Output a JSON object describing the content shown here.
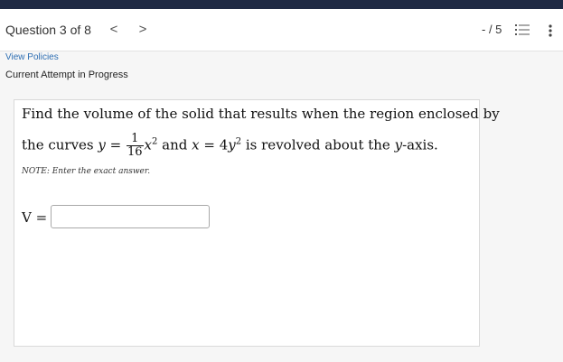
{
  "header": {
    "question_label": "Question 3 of 8",
    "prev_label": "<",
    "next_label": ">",
    "score": "- / 5"
  },
  "links": {
    "view_policies": "View Policies"
  },
  "status": {
    "attempt": "Current Attempt in Progress"
  },
  "problem": {
    "line1": "Find the volume of the solid that results when the region enclosed by",
    "curves_lead": "the curves ",
    "y_var": "y",
    "eq1": " = ",
    "frac_num": "1",
    "frac_den": "16",
    "x_var": "x",
    "exp2": "2",
    "and_text": " and ",
    "x_var2": "x",
    "eq2": " = 4",
    "y_var2": "y",
    "exp2b": "2",
    "tail_text": " is revolved about the ",
    "axis_var": "y",
    "axis_tail": "-axis.",
    "note": "NOTE: Enter the exact answer."
  },
  "answer": {
    "label": "V =",
    "value": ""
  },
  "icons": {
    "list": "list-icon",
    "more": "more-vertical-icon"
  }
}
